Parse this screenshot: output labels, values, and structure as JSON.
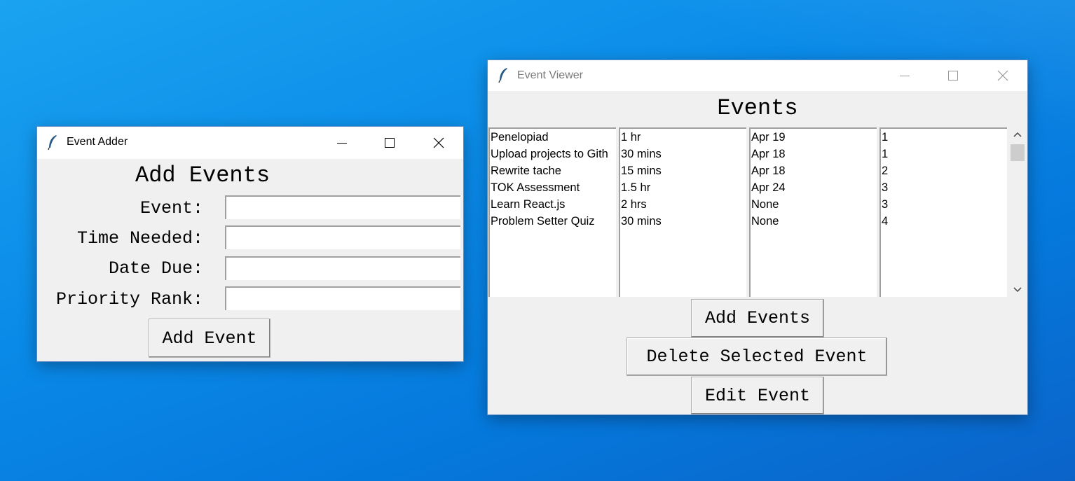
{
  "adder": {
    "title": "Event Adder",
    "heading": "Add Events",
    "labels": {
      "event": "Event:",
      "time": "Time Needed:",
      "date": "Date Due:",
      "priority": "Priority Rank:"
    },
    "values": {
      "event": "",
      "time": "",
      "date": "",
      "priority": ""
    },
    "button": "Add Event"
  },
  "viewer": {
    "title": "Event Viewer",
    "heading": "Events",
    "columns": {
      "names": [
        "Penelopiad",
        "Upload projects to Gith",
        "Rewrite tache",
        "TOK Assessment",
        "Learn React.js",
        "Problem Setter Quiz"
      ],
      "times": [
        "1 hr",
        "30 mins",
        "15 mins",
        "1.5 hr",
        "2 hrs",
        "30 mins"
      ],
      "dates": [
        "Apr 19",
        "Apr 18",
        "Apr 18",
        "Apr 24",
        "None",
        "None"
      ],
      "ranks": [
        "1",
        "1",
        "2",
        "3",
        "3",
        "4"
      ]
    },
    "buttons": {
      "add": "Add Events",
      "delete": "Delete Selected Event",
      "edit": "Edit Event"
    }
  },
  "icons": [
    "feather-icon",
    "minimize-icon",
    "maximize-icon",
    "close-icon",
    "scroll-up-icon",
    "scroll-down-icon"
  ],
  "colors": {
    "desktop": "#0a8ae8",
    "window_bg": "#f0f0f0",
    "titlebar": "#ffffff"
  }
}
